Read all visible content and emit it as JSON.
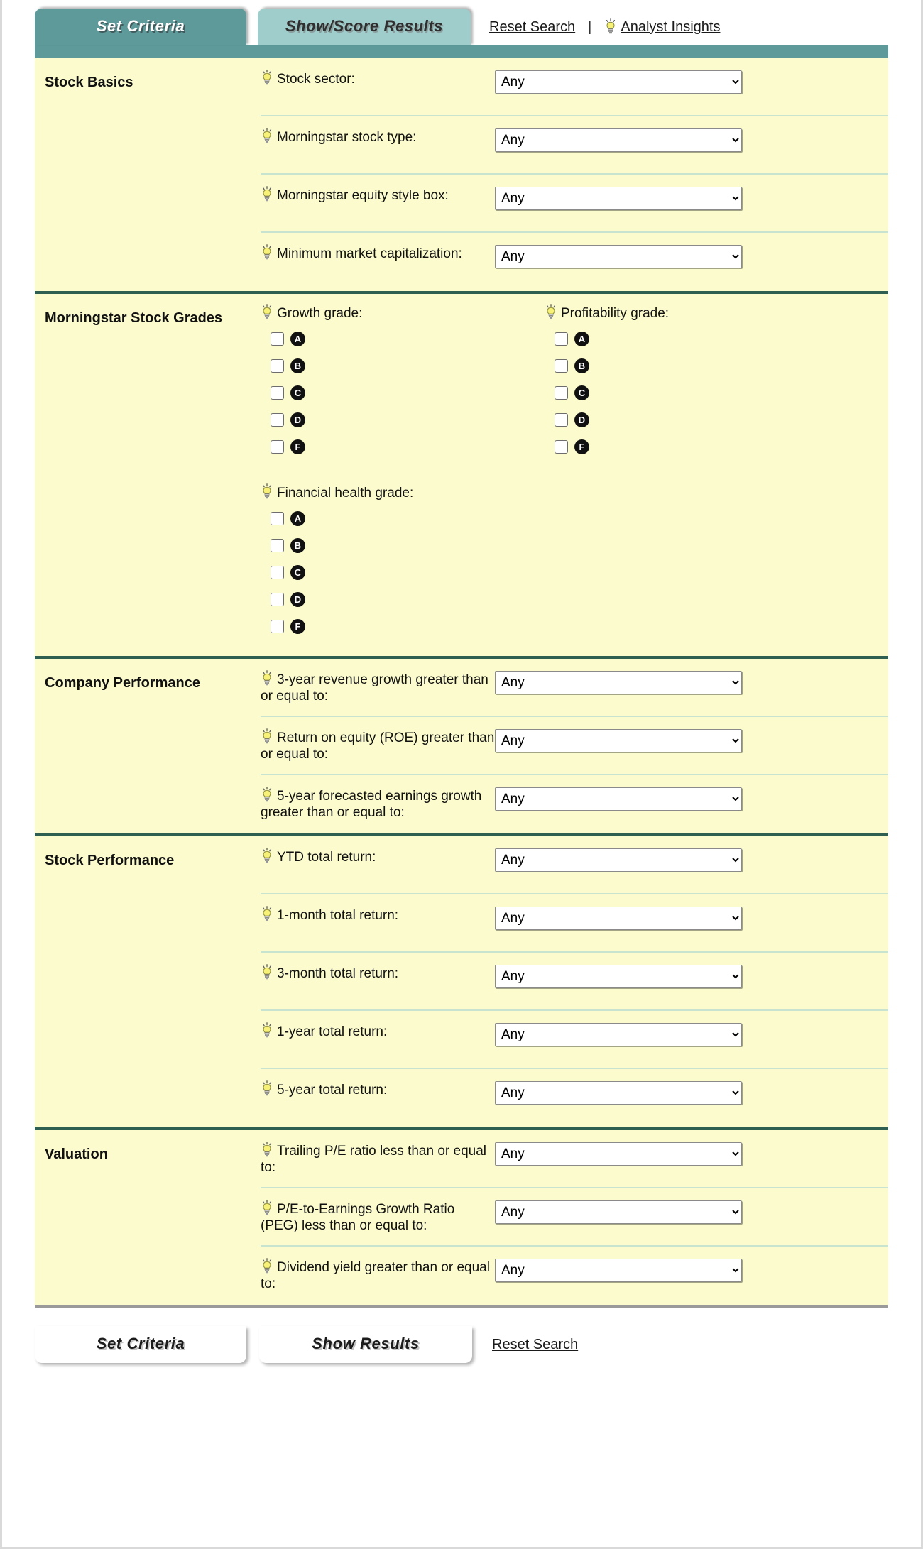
{
  "top_tabs": [
    {
      "label": "Set Criteria",
      "active": true
    },
    {
      "label": "Show/Score Results",
      "active": false
    }
  ],
  "top_links": {
    "reset": "Reset Search",
    "separator": "|",
    "analyst": "Analyst Insights"
  },
  "bottom_tabs": [
    {
      "label": "Set Criteria"
    },
    {
      "label": "Show Results"
    }
  ],
  "bottom_links": {
    "reset": "Reset Search"
  },
  "select_value": "Any",
  "select_options": [
    "Any"
  ],
  "colors": {
    "tab_active": "#5f9a9b",
    "tab_inactive": "#9fcdcb",
    "panel_bg": "#fbfbcd",
    "section_rule": "#2e5f51",
    "row_rule": "#c8e3cf",
    "badge_bg": "#111111",
    "bulb": "#f5f07a"
  },
  "sections": [
    {
      "title": "Stock Basics",
      "rows": [
        {
          "label": "Stock sector:",
          "value": "Any"
        },
        {
          "label": "Morningstar stock type:",
          "value": "Any"
        },
        {
          "label": "Morningstar equity style box:",
          "value": "Any"
        },
        {
          "label": "Minimum market capitalization:",
          "value": "Any"
        }
      ]
    },
    {
      "title": "Morningstar Stock Grades",
      "grade_groups": [
        {
          "label": "Growth grade:",
          "grades": [
            "A",
            "B",
            "C",
            "D",
            "F"
          ]
        },
        {
          "label": "Profitability grade:",
          "grades": [
            "A",
            "B",
            "C",
            "D",
            "F"
          ]
        },
        {
          "label": "Financial health grade:",
          "grades": [
            "A",
            "B",
            "C",
            "D",
            "F"
          ]
        }
      ]
    },
    {
      "title": "Company Performance",
      "rows": [
        {
          "label": "3-year revenue growth greater than or equal to:",
          "value": "Any"
        },
        {
          "label": "Return on equity (ROE) greater than or equal to:",
          "value": "Any"
        },
        {
          "label": "5-year forecasted earnings growth greater than or equal to:",
          "value": "Any"
        }
      ]
    },
    {
      "title": "Stock Performance",
      "rows": [
        {
          "label": "YTD total return:",
          "value": "Any"
        },
        {
          "label": "1-month total return:",
          "value": "Any"
        },
        {
          "label": "3-month total return:",
          "value": "Any"
        },
        {
          "label": "1-year total return:",
          "value": "Any"
        },
        {
          "label": "5-year total return:",
          "value": "Any"
        }
      ]
    },
    {
      "title": "Valuation",
      "rows": [
        {
          "label": "Trailing P/E ratio less than or equal to:",
          "value": "Any"
        },
        {
          "label": "P/E-to-Earnings Growth Ratio (PEG) less than or equal to:",
          "value": "Any"
        },
        {
          "label": "Dividend yield greater than or equal to:",
          "value": "Any"
        }
      ]
    }
  ]
}
